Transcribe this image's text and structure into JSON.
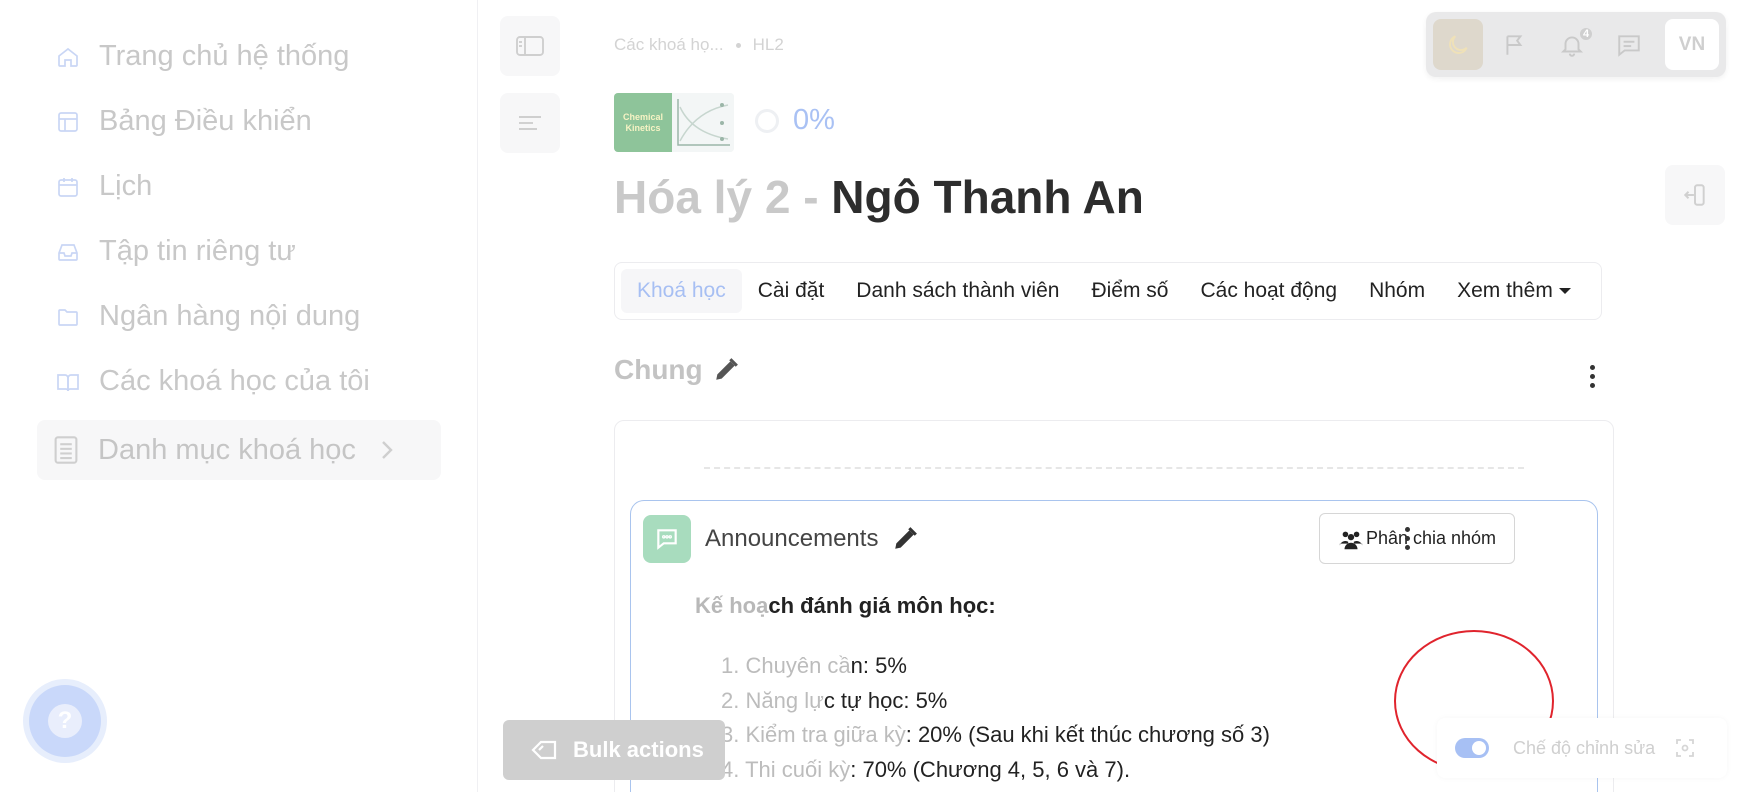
{
  "sidebar": {
    "items": [
      {
        "label": "Trang chủ hệ thống",
        "icon": "home-icon"
      },
      {
        "label": "Bảng Điều khiển",
        "icon": "dashboard-icon"
      },
      {
        "label": "Lịch",
        "icon": "calendar-icon"
      },
      {
        "label": "Tập tin riêng tư",
        "icon": "inbox-icon"
      },
      {
        "label": "Ngân hàng nội dung",
        "icon": "folder-icon"
      },
      {
        "label": "Các khoá học của tôi",
        "icon": "book-icon"
      }
    ],
    "catalog_label": "Danh mục khoá học",
    "help_label": "?"
  },
  "breadcrumb": {
    "items": [
      "Các khoá họ...",
      "HL2"
    ]
  },
  "toolbar": {
    "notification_count": "4",
    "language": "VN"
  },
  "course": {
    "thumbnail_text": "Chemical Kinetics",
    "progress": "0%",
    "title_part1": "Hóa lý 2 - ",
    "title_part2": "Ngô Thanh An"
  },
  "tabs": [
    {
      "label": "Khoá học",
      "active": true
    },
    {
      "label": "Cài đặt"
    },
    {
      "label": "Danh sách thành viên"
    },
    {
      "label": "Điểm số"
    },
    {
      "label": "Các hoạt động"
    },
    {
      "label": "Nhóm"
    },
    {
      "label": "Xem thêm"
    }
  ],
  "section": {
    "title": "Chung"
  },
  "announcement": {
    "title": "Announcements",
    "group_button": "Phân chia nhóm",
    "heading_faded": "Kế hoạ",
    "heading_rest": "ch đánh giá môn học:",
    "items": [
      {
        "num": "1.",
        "faded": "Chuyên cầ",
        "rest": "n: 5%"
      },
      {
        "num": "2.",
        "faded": "Năng lự",
        "rest": "c tự học: 5%"
      },
      {
        "num": "3.",
        "faded": "Kiểm tra giữa kỳ",
        "rest": ": 20% (Sau khi kết thúc chương số 3)"
      },
      {
        "num": "4.",
        "faded": "Thi cuối kỳ",
        "rest": ": 70% (Chương 4, 5, 6 và 7)."
      }
    ]
  },
  "footer": {
    "bulk_actions": "Bulk actions",
    "edit_mode": "Chế độ chỉnh sửa",
    "edit_mode_on": true
  },
  "colors": {
    "accent": "#a7c0f4",
    "announcement_icon": "#a8dcbe",
    "highlight_circle": "#e0242d"
  }
}
